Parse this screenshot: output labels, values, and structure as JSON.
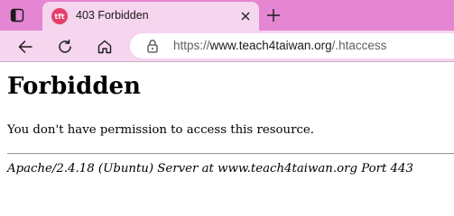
{
  "browser": {
    "tab": {
      "title": "403 Forbidden",
      "favicon_text": "tft",
      "favicon_color": "#e63f6c"
    },
    "icons": {
      "tab_actions": "tab-actions-icon",
      "close": "close-icon",
      "new_tab": "plus-icon",
      "back": "back-arrow-icon",
      "refresh": "refresh-icon",
      "home": "home-icon",
      "lock": "lock-icon"
    },
    "address": {
      "scheme": "https://",
      "host": "www.teach4taiwan.org",
      "path": "/.htaccess"
    },
    "colors": {
      "tabbar": "#e586d3",
      "toolbar": "#f6d5ef"
    }
  },
  "page": {
    "heading": "Forbidden",
    "message": "You don't have permission to access this resource.",
    "server_signature": "Apache/2.4.18 (Ubuntu) Server at www.teach4taiwan.org Port 443"
  }
}
